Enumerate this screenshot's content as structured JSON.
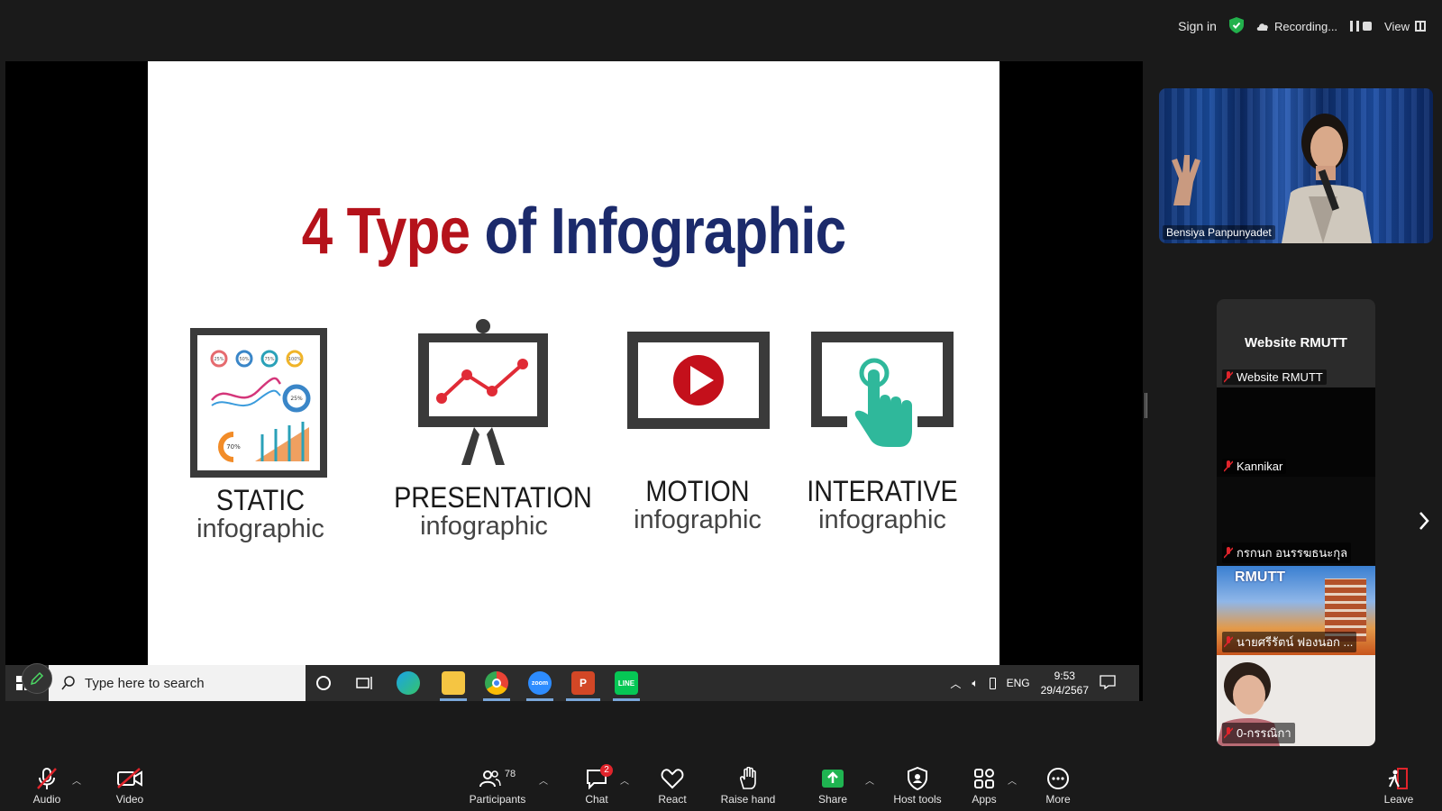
{
  "topbar": {
    "sign_in": "Sign in",
    "recording": "Recording...",
    "view": "View"
  },
  "slide": {
    "title_part1": "4 Type",
    "title_part2": " of Infographic",
    "items": [
      {
        "label1": "STATIC",
        "label2": "infographic"
      },
      {
        "label1": "PRESENTATION",
        "label2": "infographic"
      },
      {
        "label1": "MOTION",
        "label2": "infographic"
      },
      {
        "label1": "INTERATIVE",
        "label2": "infographic"
      }
    ],
    "chart_labels": [
      "25%",
      "50%",
      "75%",
      "100%",
      "25%",
      "70%"
    ]
  },
  "taskbar": {
    "search_placeholder": "Type here to search",
    "lang": "ENG",
    "time": "9:53",
    "date": "29/4/2567"
  },
  "speaker": {
    "name": "Bensiya Panpunyadet"
  },
  "gallery": {
    "top_title": "Website RMUTT",
    "participants": [
      {
        "name": "Website RMUTT"
      },
      {
        "name": "Kannikar"
      },
      {
        "name": "กรกนก อนรรฆธนะกุล"
      },
      {
        "name": "นายศรีรัตน์ ฟองนอก ..."
      },
      {
        "name": "0-กรรณิกา"
      }
    ],
    "rmutt_logo_text": "RMUTT"
  },
  "toolbar": {
    "audio": "Audio",
    "video": "Video",
    "participants": "Participants",
    "participants_count": "78",
    "chat": "Chat",
    "chat_badge": "2",
    "react": "React",
    "raise_hand": "Raise hand",
    "share": "Share",
    "host_tools": "Host tools",
    "apps": "Apps",
    "more": "More",
    "leave": "Leave"
  },
  "colors": {
    "title_red": "#b5121b",
    "title_navy": "#1b2a6b",
    "share_green": "#1fb451",
    "mic_off_red": "#e0242b"
  }
}
